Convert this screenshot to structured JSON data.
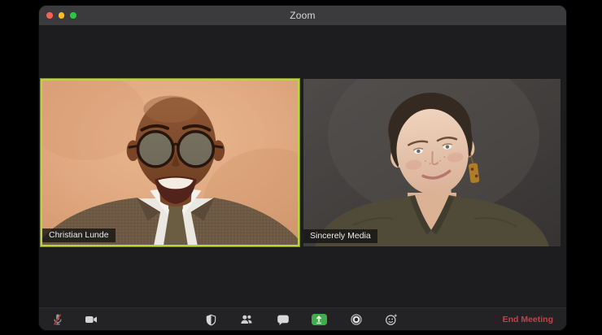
{
  "window": {
    "title": "Zoom"
  },
  "titlebar": {
    "buttons": [
      {
        "name": "close",
        "color": "#f85f57"
      },
      {
        "name": "minimize",
        "color": "#fdbc2e"
      },
      {
        "name": "zoom-fullscreen",
        "color": "#28c840"
      }
    ]
  },
  "participants": [
    {
      "name": "Christian Lunde",
      "active_speaker": true
    },
    {
      "name": "Sincerely Media",
      "active_speaker": false
    }
  ],
  "toolbar": {
    "left_items": [
      {
        "label": "mute",
        "icon": "microphone-muted-icon",
        "state": "muted"
      },
      {
        "label": "video",
        "icon": "video-camera-icon",
        "state": "on"
      }
    ],
    "center_items": [
      {
        "label": "security",
        "icon": "shield-icon"
      },
      {
        "label": "participants",
        "icon": "participants-icon"
      },
      {
        "label": "chat",
        "icon": "chat-bubble-icon"
      },
      {
        "label": "share-screen",
        "icon": "share-screen-icon"
      },
      {
        "label": "record",
        "icon": "record-icon"
      },
      {
        "label": "reactions",
        "icon": "reactions-icon"
      }
    ],
    "end_meeting_label": "End Meeting"
  },
  "colors": {
    "active_speaker_border": "#bdd33f",
    "share_screen_green": "#3fae4a",
    "end_meeting_red": "#c2424c",
    "titlebar_bg": "#3b3b3d",
    "window_bg": "#1d1d1f",
    "toolbar_bg": "#232326",
    "mic_muted_slash": "#c0392f"
  }
}
